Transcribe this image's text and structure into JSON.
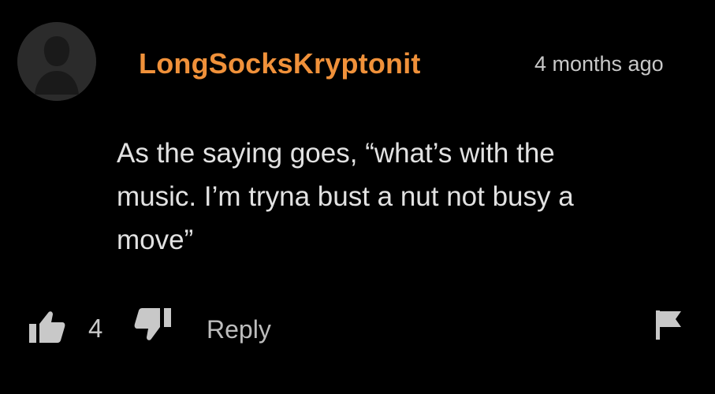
{
  "comment": {
    "avatar_icon": "default-user-avatar-icon",
    "username": "LongSocksKryptonit",
    "timestamp": "4 months ago",
    "body_lines": [
      "As the saying goes, “what’s with the",
      "music. I’m tryna bust a nut not busy a",
      "move”"
    ],
    "like_count": "4",
    "reply_label": "Reply",
    "icons": {
      "like": "thumbs-up-icon",
      "dislike": "thumbs-down-icon",
      "flag": "flag-icon"
    },
    "colors": {
      "background": "#000000",
      "username": "#f0913a",
      "text": "#e2e2e2",
      "muted": "#c8c8c8",
      "avatar_bg": "#2b2b2b"
    }
  }
}
